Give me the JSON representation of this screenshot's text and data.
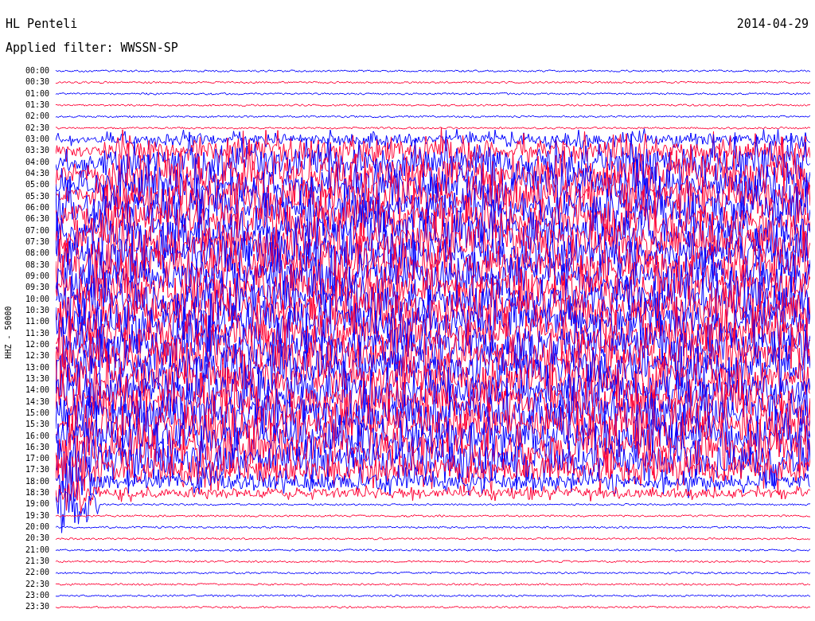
{
  "header": {
    "station": "HL Penteli",
    "date": "2014-04-29",
    "filter": "Applied filter: WWSSN-SP"
  },
  "plot": {
    "channel_label": "HHZ - 50000",
    "time_labels": [
      "00:00",
      "00:30",
      "01:00",
      "01:30",
      "02:00",
      "02:30",
      "03:00",
      "03:30",
      "04:00",
      "04:30",
      "05:00",
      "05:30",
      "06:00",
      "06:30",
      "07:00",
      "07:30",
      "08:00",
      "08:30",
      "09:00",
      "09:30",
      "10:00",
      "10:30",
      "11:00",
      "11:30",
      "12:00",
      "12:30",
      "13:00",
      "13:30",
      "14:00",
      "14:30",
      "15:00",
      "15:30",
      "16:00",
      "16:30",
      "17:00",
      "17:30",
      "18:00",
      "18:30",
      "19:00",
      "19:30",
      "20:00",
      "20:30",
      "21:00",
      "21:30",
      "22:00",
      "22:30",
      "23:00",
      "23:30"
    ]
  }
}
